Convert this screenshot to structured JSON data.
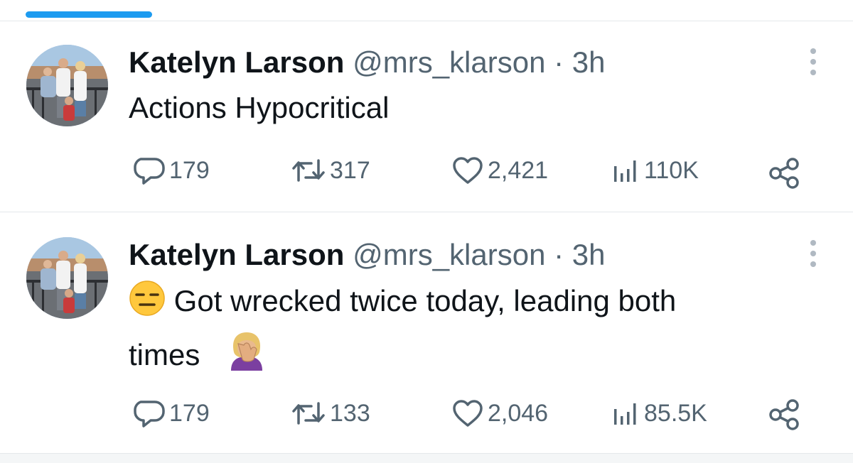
{
  "tweets": [
    {
      "display_name": "Katelyn Larson",
      "handle": "@mrs_klarson",
      "separator": "·",
      "time": "3h",
      "text": "Actions Hypocritical",
      "text_line2": "",
      "lead_emoji": "",
      "trail_emoji": "",
      "replies": "179",
      "reposts": "317",
      "likes": "2,421",
      "views": "110K"
    },
    {
      "display_name": "Katelyn Larson",
      "handle": "@mrs_klarson",
      "separator": "·",
      "time": "3h",
      "text": "Got wrecked twice today, leading both",
      "text_line2": "times",
      "lead_emoji": "expressionless-face-emoji",
      "trail_emoji": "woman-facepalming-emoji",
      "replies": "179",
      "reposts": "133",
      "likes": "2,046",
      "views": "85.5K"
    }
  ],
  "icons": {
    "reply": "reply-icon",
    "repost": "repost-icon",
    "like": "like-icon",
    "views": "views-icon",
    "share": "share-icon",
    "more": "more-icon"
  },
  "colors": {
    "accent": "#1d9bf0",
    "text": "#0f1419",
    "secondary": "#536471",
    "divider": "#e4e8eb"
  }
}
